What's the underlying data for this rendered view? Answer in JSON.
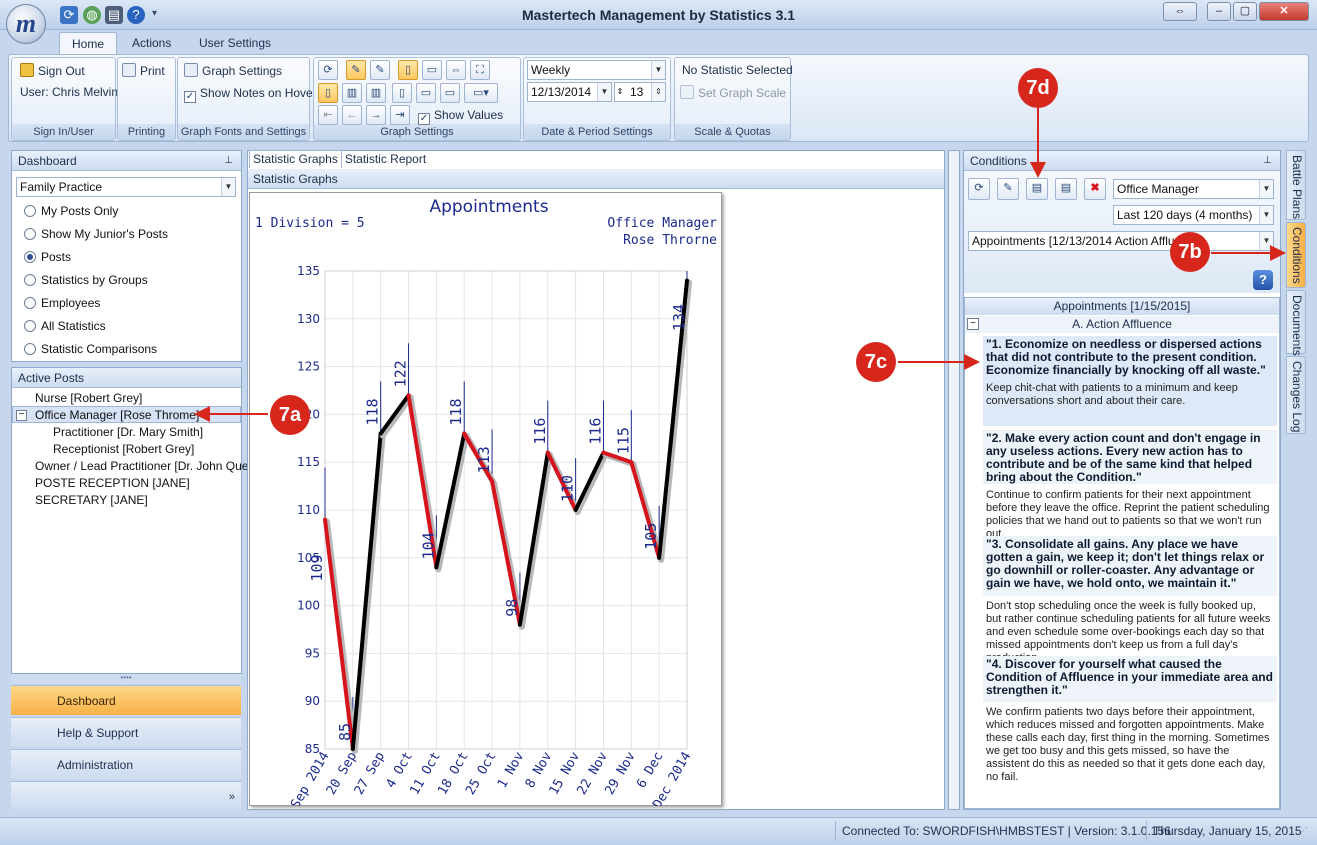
{
  "window": {
    "title": "Mastertech Management by Statistics 3.1",
    "logo_letter": "m"
  },
  "ribbon_tabs": [
    {
      "label": "Home"
    },
    {
      "label": "Actions"
    },
    {
      "label": "User Settings"
    }
  ],
  "ribbon": {
    "signin": {
      "signout": "Sign Out",
      "user": "User: Chris Melvin",
      "group": "Sign In/User"
    },
    "printing": {
      "print": "Print",
      "group": "Printing"
    },
    "fonts": {
      "graph_settings": "Graph Settings",
      "show_notes": "Show Notes on Hover",
      "group": "Graph Fonts and Settings"
    },
    "graph": {
      "show_values": "Show Values",
      "group": "Graph Settings"
    },
    "date": {
      "period": "Weekly",
      "date": "12/13/2014",
      "count": "13",
      "group": "Date & Period Settings"
    },
    "scale": {
      "no_stat": "No Statistic Selected",
      "set_scale": "Set Graph Scale",
      "group": "Scale & Quotas"
    }
  },
  "dashboard": {
    "title": "Dashboard",
    "selector": "Family Practice",
    "options": [
      {
        "label": "My Posts Only",
        "selected": false
      },
      {
        "label": "Show My Junior's Posts",
        "selected": false
      },
      {
        "label": "Posts",
        "selected": true
      },
      {
        "label": "Statistics by Groups",
        "selected": false
      },
      {
        "label": "Employees",
        "selected": false
      },
      {
        "label": "All Statistics",
        "selected": false
      },
      {
        "label": "Statistic Comparisons",
        "selected": false
      }
    ]
  },
  "active_posts": {
    "title": "Active Posts",
    "items": [
      {
        "label": "Nurse [Robert Grey]",
        "level": 1
      },
      {
        "label": "Office Manager [Rose Throme]",
        "level": 1,
        "selected": true,
        "expander": "−"
      },
      {
        "label": "Practitioner  [Dr. Mary Smith]",
        "level": 2
      },
      {
        "label": "Receptionist  [Robert Grey]",
        "level": 2
      },
      {
        "label": "Owner / Lead Practitioner  [Dr. John Que]",
        "level": 1
      },
      {
        "label": "POSTE RECEPTION [JANE]",
        "level": 1
      },
      {
        "label": "SECRETARY [JANE]",
        "level": 1
      }
    ]
  },
  "nav": {
    "dashboard": "Dashboard",
    "help": "Help & Support",
    "admin": "Administration"
  },
  "doc_tabs": [
    {
      "label": "Statistic Graphs"
    },
    {
      "label": "Statistic Report"
    }
  ],
  "graph_panel_title": "Statistic Graphs",
  "chart_data": {
    "type": "line",
    "title": "Appointments",
    "division_note": "1 Division = 5",
    "post": "Office Manager",
    "person": "Rose Throrne",
    "categories": [
      "13 Sep 2014",
      "20 Sep",
      "27 Sep",
      "4 Oct",
      "11 Oct",
      "18 Oct",
      "25 Oct",
      "1 Nov",
      "8 Nov",
      "15 Nov",
      "22 Nov",
      "29 Nov",
      "6 Dec",
      "13 Dec 2014"
    ],
    "values": [
      109,
      85,
      118,
      122,
      104,
      118,
      113,
      98,
      116,
      110,
      116,
      115,
      105,
      134
    ],
    "ylim": [
      85,
      135
    ],
    "yticks": [
      85,
      90,
      95,
      100,
      105,
      110,
      115,
      120,
      125,
      130,
      135
    ],
    "grid": true,
    "colors": {
      "down": "#d6141e",
      "up": "#000000",
      "labels": "#1b2a8c"
    }
  },
  "conditions": {
    "title": "Conditions",
    "post_select": "Office Manager",
    "range_select": "Last 120 days (4 months)",
    "stat_select": "Appointments [12/13/2014 Action Affluence]",
    "header": "Appointments [1/15/2015]",
    "condition_name": "A. Action Affluence",
    "expander": "−",
    "items": [
      {
        "heading": "\"1. Economize on needless or dispersed actions that did not contribute to the present condition. Economize financially by knocking off all waste.\"",
        "body": "Keep chit-chat with patients to a minimum and keep conversations short and about their care."
      },
      {
        "heading": "\"2. Make every action count and don't engage in any useless actions. Every new action has to contribute and be of the same kind that helped bring about the Condition.\"",
        "body": "Continue to confirm patients for their next appointment before they leave the office. Reprint the patient scheduling policies that we hand out to patients so that we won't run out."
      },
      {
        "heading": "\"3. Consolidate all gains. Any place we have gotten a gain, we keep it; don't let things relax or go downhill or roller-coaster. Any advantage or gain we have, we hold onto, we maintain it.\"",
        "body": "Don't stop scheduling once the week is fully booked up, but rather continue scheduling patients for all future weeks and even schedule some over-bookings each day so that missed appointments don't keep us from a full day's production."
      },
      {
        "heading": "\"4. Discover for yourself what caused the Condition of Affluence in your immediate area and strengthen it.\"",
        "body": "We confirm patients two days before their appointment, which reduces missed and forgotten appointments. Make these calls each day, first thing in the morning. Sometimes we get too busy and this gets missed, so have the assistent do this as needed so that it gets done each day, no fail."
      }
    ]
  },
  "side_tabs": [
    {
      "label": "Battle Plans"
    },
    {
      "label": "Conditions"
    },
    {
      "label": "Documents"
    },
    {
      "label": "Changes Log"
    }
  ],
  "callouts": {
    "a": "7a",
    "b": "7b",
    "c": "7c",
    "d": "7d"
  },
  "status": {
    "connection": "Connected To: SWORDFISH\\HMBSTEST | Version: 3.1.0.156",
    "date": "Thursday, January 15, 2015"
  }
}
